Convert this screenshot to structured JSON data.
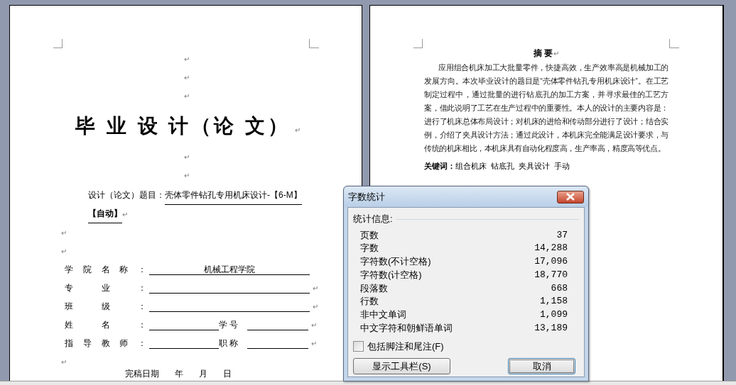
{
  "cover_page": {
    "blocks": [
      {
        "kind": "blank",
        "mark": "↵"
      },
      {
        "kind": "blank",
        "mark": "↵"
      },
      {
        "kind": "blank",
        "mark": "↵"
      },
      {
        "kind": "title",
        "text": "毕 业 设 计（论 文）",
        "mark": "↵"
      },
      {
        "kind": "blank",
        "mark": "↵"
      },
      {
        "kind": "blank",
        "mark": "↵"
      },
      {
        "kind": "topic",
        "label": "设计（论文）题目：",
        "value": "壳体零件钻孔专用机床设计-【6-M】",
        "value_2": "【自动】",
        "mark": "↵"
      },
      {
        "kind": "blank_left",
        "mark": "↵"
      },
      {
        "kind": "blank_left",
        "mark": "↵"
      },
      {
        "kind": "field",
        "label": "学院名称：",
        "value": "机械工程学院"
      },
      {
        "kind": "field",
        "label": "专业：",
        "mark": "↵"
      },
      {
        "kind": "field",
        "label": "班级：",
        "mark": "↵"
      },
      {
        "kind": "pair",
        "label": "姓名：",
        "label_2": "学 号",
        "mark": "↵"
      },
      {
        "kind": "pair",
        "label": "指导教师：",
        "label_2": "职 称",
        "mark": "↵"
      },
      {
        "kind": "blank_left",
        "mark": "↵"
      },
      {
        "kind": "date",
        "parts": [
          "完稿日期",
          "年",
          "月",
          "日"
        ]
      }
    ]
  },
  "abstract_page": {
    "heading": "摘 要",
    "heading_mark": "↵",
    "paragraph": "应用组合机床加工大批量零件，快捷高效，生产效率高是机械加工的发展方向。本次毕业设计的题目是“壳体零件钻孔专用机床设计”。在工艺制定过程中，通过批量的进行钻底孔的加工方案，并寻求最佳的工艺方案，借此说明了工艺在生产过程中的重要性。本人的设计的主要内容是：进行了机床总体布局设计；对机床的进给和传动部分进行了设计；结合实例，介绍了夹具设计方法；通过此设计，本机床完全能满足设计要求，与传统的机床相比，本机床具有自动化程度高，生产率高，精度高等优点。",
    "keywords_label": "关键词：",
    "keywords": "组合机床  钻底孔  夹具设计  手动"
  },
  "dialog": {
    "title": "字数统计",
    "section": "统计信息:",
    "stats": [
      {
        "label": "页数",
        "value": "37"
      },
      {
        "label": "字数",
        "value": "14,288"
      },
      {
        "label": "字符数(不计空格)",
        "value": "17,096"
      },
      {
        "label": "字符数(计空格)",
        "value": "18,770"
      },
      {
        "label": "段落数",
        "value": "668"
      },
      {
        "label": "行数",
        "value": "1,158"
      },
      {
        "label": "非中文单词",
        "value": "1,099"
      },
      {
        "label": "中文字符和朝鲜语单词",
        "value": "13,189"
      }
    ],
    "checkbox": {
      "label": "包括脚注和尾注(F)",
      "checked": false
    },
    "buttons": [
      {
        "label": "显示工具栏(S)",
        "focused": false
      },
      {
        "label": "取消",
        "focused": true
      }
    ]
  }
}
